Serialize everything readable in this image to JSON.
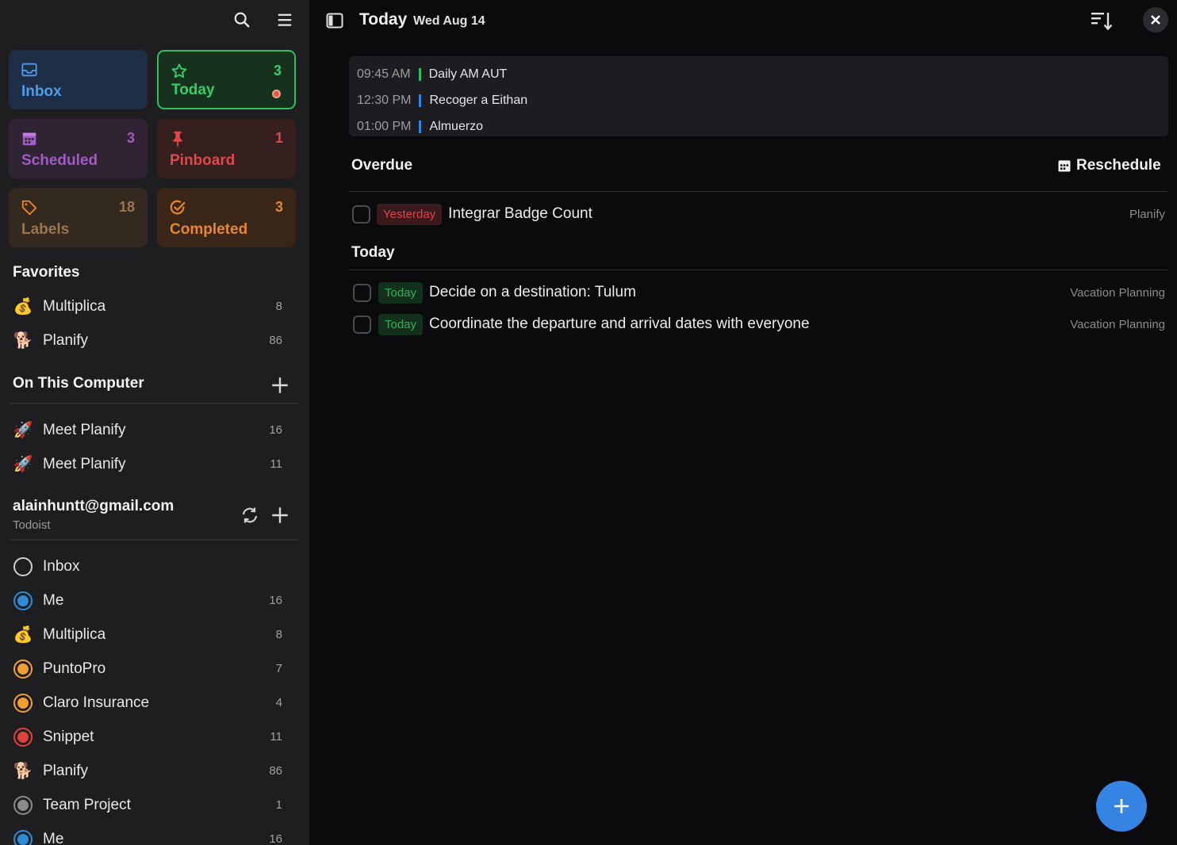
{
  "sidebar": {
    "tiles": {
      "inbox": {
        "label": "Inbox",
        "count": ""
      },
      "today": {
        "label": "Today",
        "count": "3"
      },
      "scheduled": {
        "label": "Scheduled",
        "count": "3"
      },
      "pinboard": {
        "label": "Pinboard",
        "count": "1"
      },
      "labels": {
        "label": "Labels",
        "count": "18"
      },
      "completed": {
        "label": "Completed",
        "count": "3"
      }
    },
    "favorites": {
      "title": "Favorites",
      "items": [
        {
          "label": "Multiplica",
          "count": "8",
          "icon": "💰"
        },
        {
          "label": "Planify",
          "count": "86",
          "icon": "🐕"
        }
      ]
    },
    "local": {
      "title": "On This Computer",
      "items": [
        {
          "label": "Meet Planify",
          "count": "16",
          "icon": "🚀"
        },
        {
          "label": "Meet Planify",
          "count": "11",
          "icon": "🚀"
        }
      ]
    },
    "account": {
      "email": "alainhuntt@gmail.com",
      "provider": "Todoist",
      "items": [
        {
          "label": "Inbox",
          "count": "",
          "icon": "ring-empty"
        },
        {
          "label": "Me",
          "count": "16",
          "icon": "ring-blue"
        },
        {
          "label": "Multiplica",
          "count": "8",
          "icon": "💰"
        },
        {
          "label": "PuntoPro",
          "count": "7",
          "icon": "ring-orange"
        },
        {
          "label": "Claro Insurance",
          "count": "4",
          "icon": "ring-orange"
        },
        {
          "label": "Snippet",
          "count": "11",
          "icon": "ring-red"
        },
        {
          "label": "Planify",
          "count": "86",
          "icon": "🐕"
        },
        {
          "label": "Team Project",
          "count": "1",
          "icon": "ring-grey"
        },
        {
          "label": "Me",
          "count": "16",
          "icon": "ring-blue"
        }
      ]
    }
  },
  "colors": {
    "accent_blue": "#3584e4",
    "ring_blue": "#2e8bd6",
    "ring_orange": "#f0a030",
    "ring_red": "#e0403c",
    "ring_grey": "#8a8a8a"
  },
  "header": {
    "title": "Today",
    "date": "Wed Aug 14"
  },
  "events": [
    {
      "time": "09:45 AM",
      "title": "Daily AM AUT",
      "color": "#2fbf63"
    },
    {
      "time": "12:30 PM",
      "title": "Recoger a Eithan",
      "color": "#3584e4"
    },
    {
      "time": "01:00 PM",
      "title": "Almuerzo",
      "color": "#3584e4"
    }
  ],
  "overdue": {
    "title": "Overdue",
    "reschedule_label": "Reschedule",
    "tasks": [
      {
        "chip": "Yesterday",
        "title": "Integrar Badge Count",
        "project": "Planify"
      }
    ]
  },
  "today_section": {
    "title": "Today",
    "tasks": [
      {
        "chip": "Today",
        "title": "Decide on a destination: Tulum",
        "project": "Vacation Planning"
      },
      {
        "chip": "Today",
        "title": "Coordinate the departure and arrival dates with everyone",
        "project": "Vacation Planning"
      }
    ]
  }
}
